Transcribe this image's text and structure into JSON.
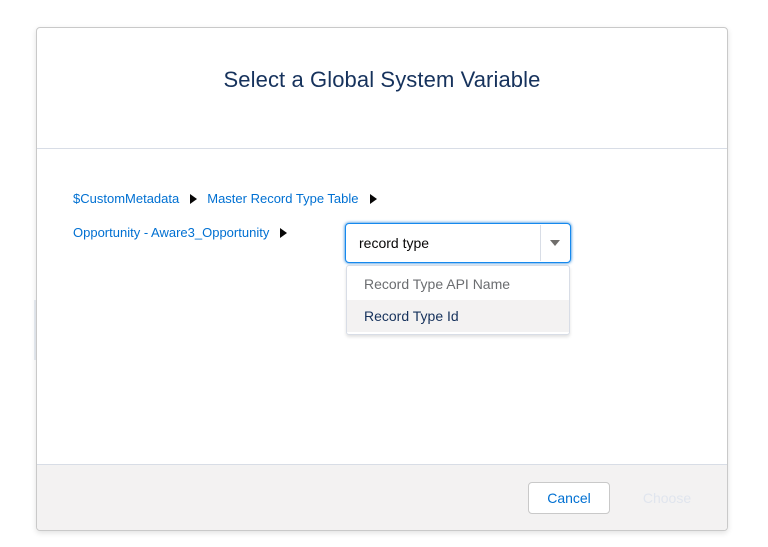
{
  "dialog": {
    "title": "Select a Global System Variable"
  },
  "breadcrumbs": {
    "row1": [
      "$CustomMetadata",
      "Master Record Type Table"
    ],
    "row2": [
      "Opportunity - Aware3_Opportunity"
    ]
  },
  "field_picker": {
    "value": "record type",
    "options": [
      {
        "label": "Record Type API Name",
        "state": "dimmed"
      },
      {
        "label": "Record Type Id",
        "state": "highlighted"
      }
    ]
  },
  "footer": {
    "cancel_label": "Cancel",
    "choose_label": "Choose"
  },
  "colors": {
    "link": "#0070d2",
    "title": "#16325c",
    "focus_border": "#1589ee",
    "footer_bg": "#f3f2f2",
    "highlight_bg": "#f3f2f2"
  },
  "icons": {
    "breadcrumb_separator": "right-triangle-icon",
    "combo_toggle": "caret-down-icon"
  }
}
